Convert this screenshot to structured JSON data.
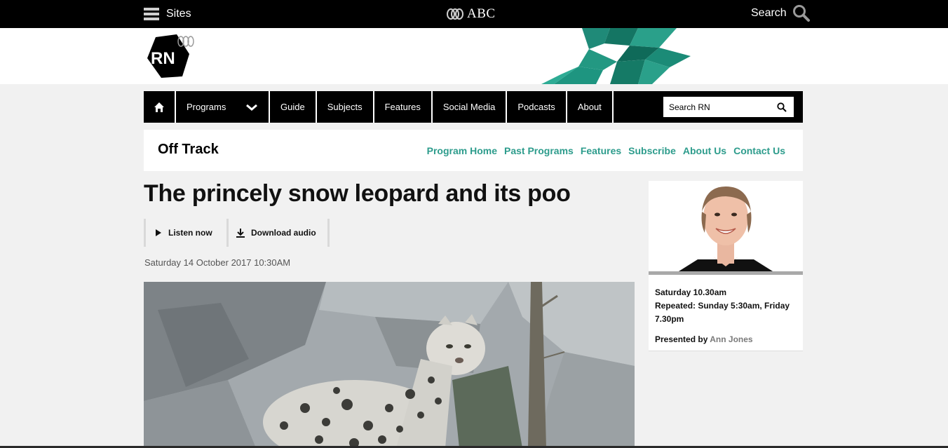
{
  "global_bar": {
    "sites_label": "Sites",
    "brand": "ABC",
    "search_label": "Search",
    "icons": [
      "hamburger-icon",
      "abc-lissajous-icon",
      "magnifier-icon"
    ]
  },
  "masthead": {
    "logo_text": "RN"
  },
  "rn_nav": {
    "items": [
      {
        "label": "Programs"
      },
      {
        "label": "Guide"
      },
      {
        "label": "Subjects"
      },
      {
        "label": "Features"
      },
      {
        "label": "Social Media"
      },
      {
        "label": "Podcasts"
      },
      {
        "label": "About"
      }
    ],
    "search_placeholder": "Search RN"
  },
  "program": {
    "title": "Off Track",
    "links": [
      "Program Home",
      "Past Programs",
      "Features",
      "Subscribe",
      "About Us",
      "Contact Us"
    ]
  },
  "article": {
    "title": "The princely snow leopard and its poo",
    "listen_label": "Listen now",
    "download_label": "Download audio",
    "date": "Saturday 14 October 2017 10:30AM"
  },
  "sidebar": {
    "schedule": "Saturday 10.30am",
    "repeated": "Repeated: Sunday 5:30am, Friday 7.30pm",
    "presented_by_label": "Presented by",
    "presenter": "Ann Jones"
  },
  "colors": {
    "accent_teal": "#2d9c8c",
    "nav_bg": "#000000",
    "page_bg": "#f1f1f1"
  }
}
